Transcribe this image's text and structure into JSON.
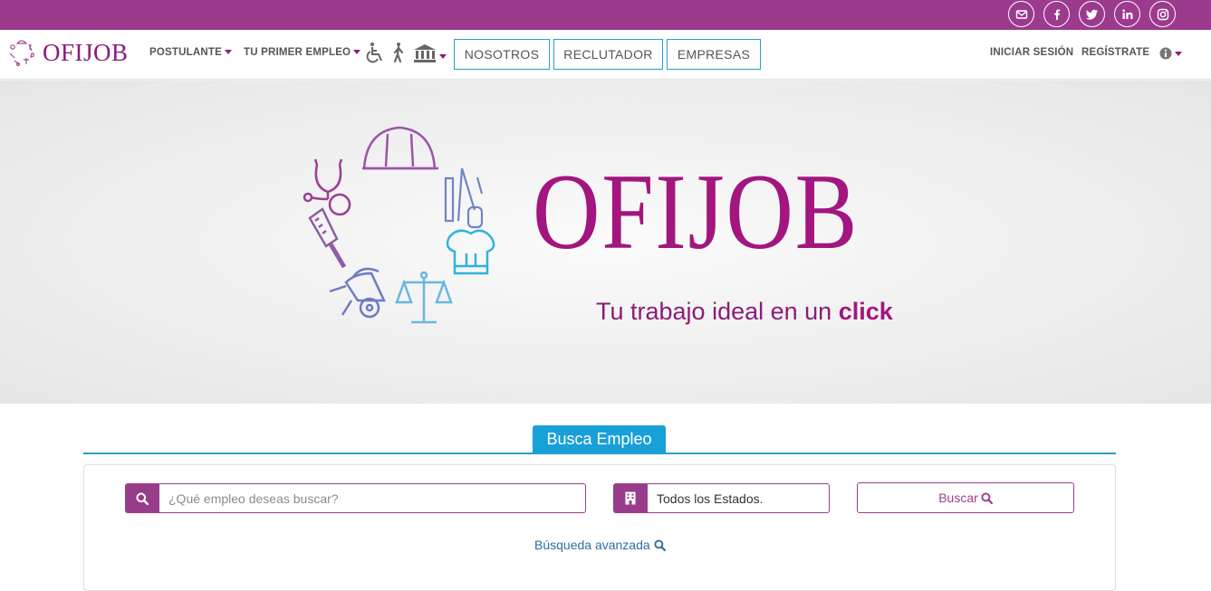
{
  "social": [
    {
      "name": "email-icon"
    },
    {
      "name": "facebook-icon"
    },
    {
      "name": "twitter-icon"
    },
    {
      "name": "linkedin-icon"
    },
    {
      "name": "instagram-icon"
    }
  ],
  "brand": {
    "name": "OFIJOB"
  },
  "nav": {
    "postulante": "POSTULANTE",
    "primer_empleo": "TU PRIMER EMPLEO",
    "nosotros": "NOSOTROS",
    "reclutador": "RECLUTADOR",
    "empresas": "EMPRESAS",
    "iniciar_sesion": "INICIAR SESIÓN",
    "registrate": "REGÍSTRATE"
  },
  "hero": {
    "title": "OFIJOB",
    "tagline_prefix": "Tu trabajo ideal en un ",
    "tagline_bold": "click"
  },
  "search": {
    "tab": "Busca Empleo",
    "query_placeholder": "¿Qué empleo deseas buscar?",
    "state_value": "Todos los Estados.",
    "button_label": "Buscar",
    "advanced_label": "Búsqueda avanzada"
  },
  "colors": {
    "brand_purple": "#9c3a8e",
    "logo_magenta": "#a3157f",
    "accent_blue": "#18a0d8"
  }
}
